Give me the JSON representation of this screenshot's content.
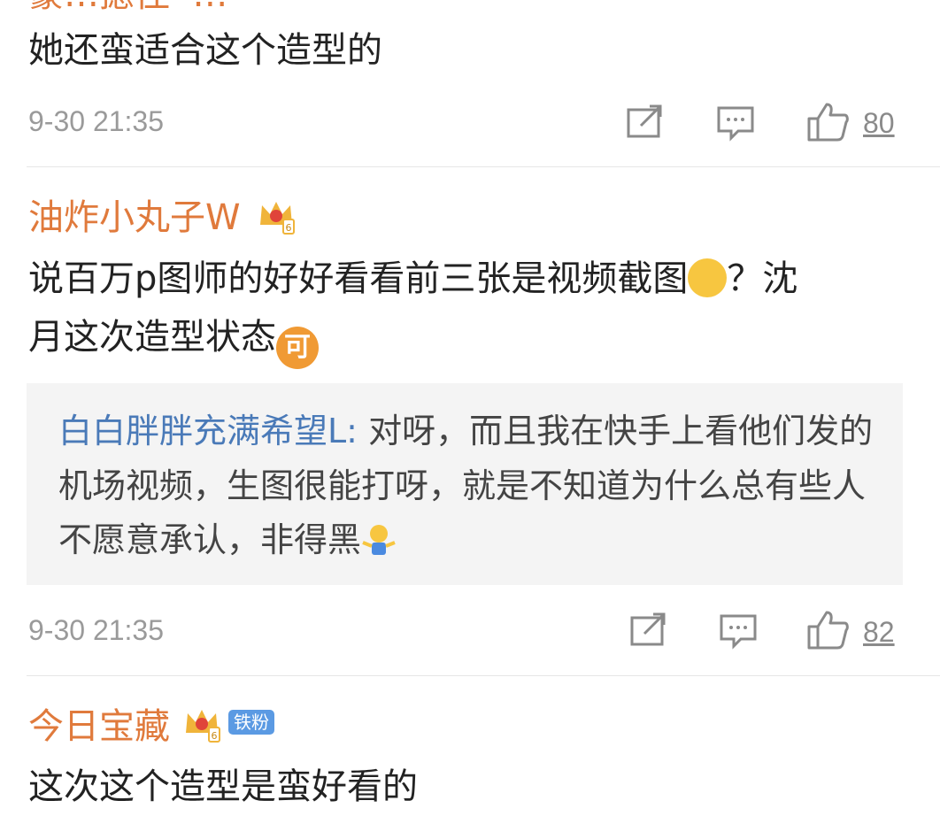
{
  "comment0": {
    "name_partial": "豪…撼佳 ·…",
    "text": "她还蛮适合这个造型的",
    "time": "9-30 21:35",
    "likes": "80"
  },
  "comment1": {
    "name": "油炸小丸子W",
    "text_a": "说百万p图师的好好看看前三张是视频截图",
    "text_b": "？沈",
    "text_c": "月这次造型状态",
    "emoji_ke": "可",
    "reply": {
      "name": "白白胖胖充满希望L:",
      "text": " 对呀，而且我在快手上看他们发的机场视频，生图很能打呀，就是不知道为什么总有些人不愿意承认，非得黑"
    },
    "time": "9-30 21:35",
    "likes": "82"
  },
  "comment2": {
    "name": "今日宝藏",
    "badge": "铁粉",
    "text": "这次这个造型是蛮好看的"
  },
  "icons": {
    "share": "share-icon",
    "comment": "comment-icon",
    "like": "thumbs-up-icon",
    "crown": "crown-icon"
  }
}
